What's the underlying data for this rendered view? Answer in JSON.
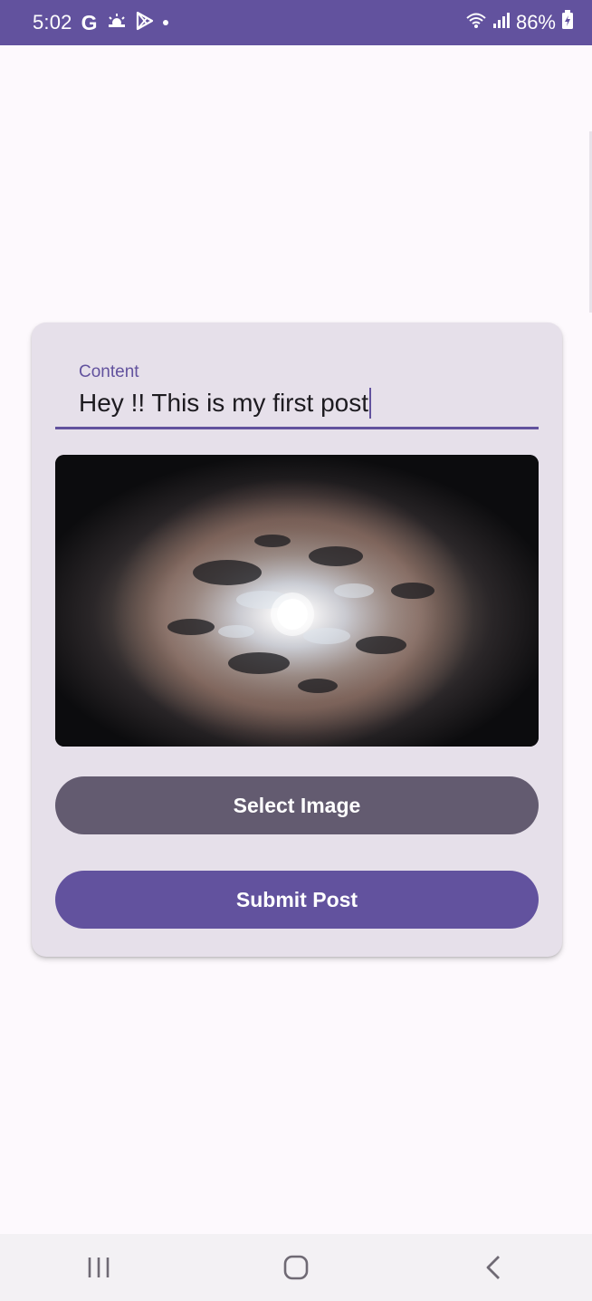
{
  "status_bar": {
    "time": "5:02",
    "battery": "86%",
    "left_icons": [
      "google-icon",
      "weather-icon",
      "play-store-icon",
      "dot-icon"
    ],
    "right_icons": [
      "wifi-icon",
      "signal-icon",
      "battery-charging-icon"
    ],
    "background": "#62529e"
  },
  "form": {
    "content_label": "Content",
    "content_value": "Hey !! This is my first post",
    "image_alt": "moon-cloudy-night-photo",
    "select_image_label": "Select Image",
    "submit_label": "Submit Post"
  },
  "colors": {
    "primary": "#62529e",
    "secondary_button": "#635b70",
    "card_bg": "#e6e0ea"
  },
  "nav_bar": {
    "buttons": [
      "recent-apps",
      "home",
      "back"
    ]
  }
}
